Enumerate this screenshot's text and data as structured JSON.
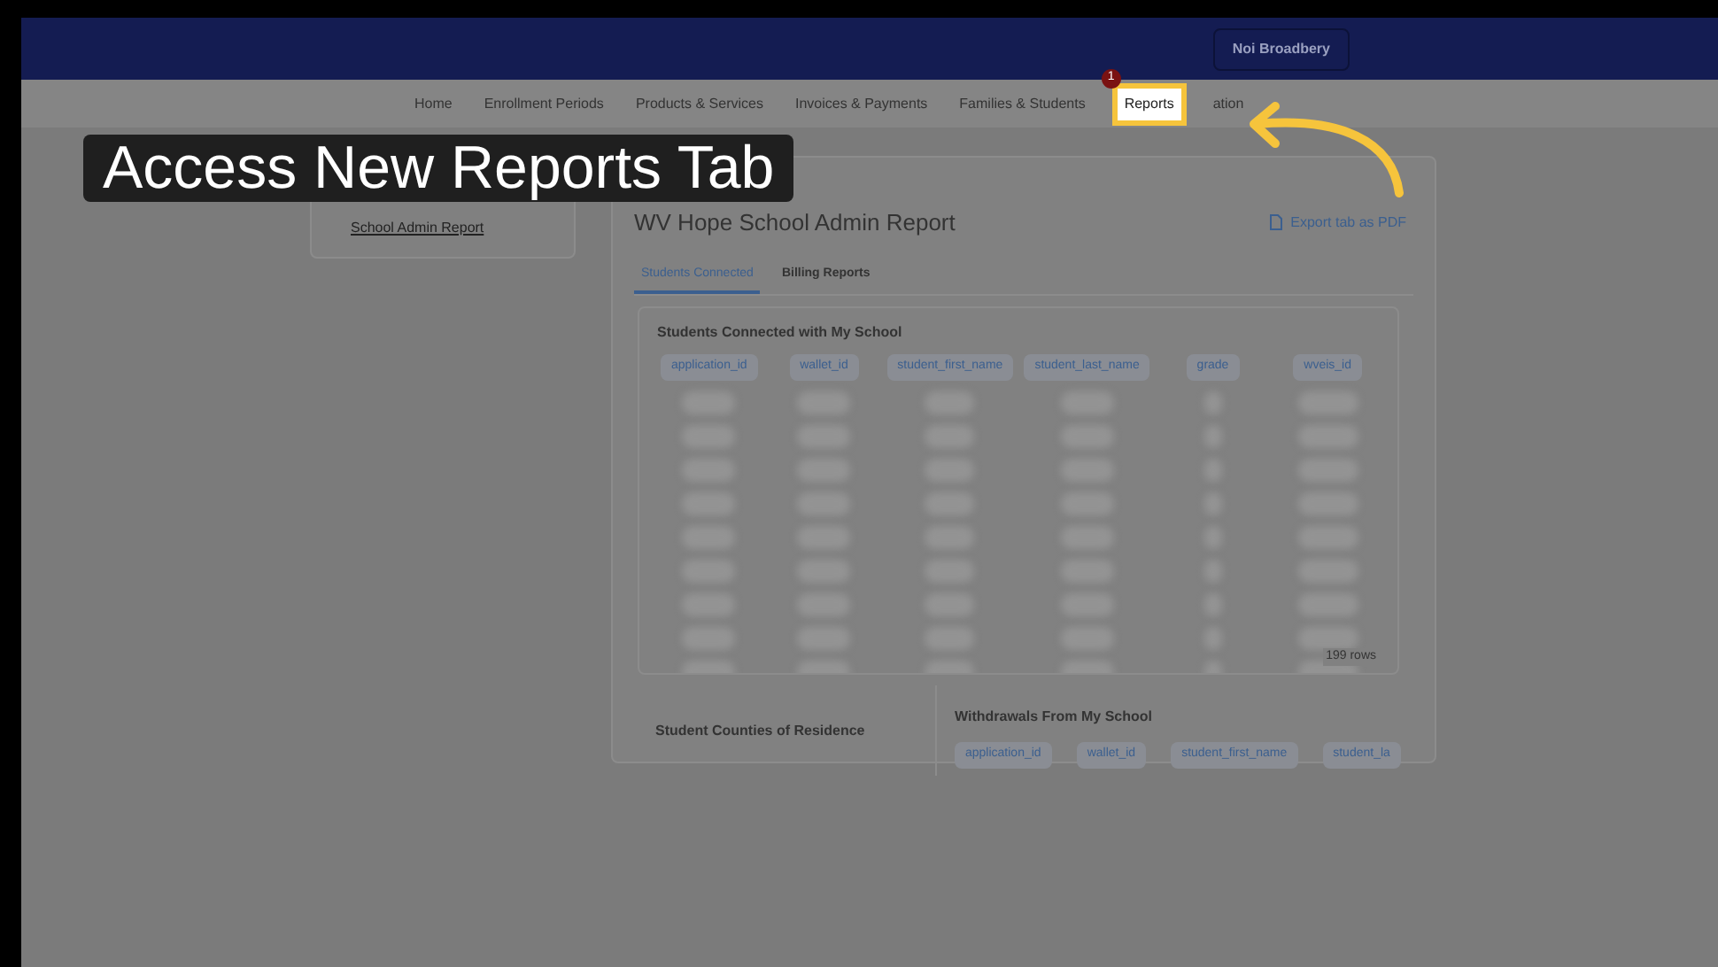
{
  "header": {
    "user_button": "Noi Broadbery"
  },
  "nav": [
    {
      "label": "Home",
      "selected": false
    },
    {
      "label": "Enrollment Periods",
      "selected": false
    },
    {
      "label": "Products & Services",
      "selected": false
    },
    {
      "label": "Invoices & Payments",
      "selected": false
    },
    {
      "label": "Families & Students",
      "selected": false
    },
    {
      "label": "Reports",
      "selected": true,
      "badge": "1"
    },
    {
      "label": "ation",
      "selected": false
    }
  ],
  "callout": {
    "text": "Access New Reports Tab"
  },
  "sidebar": {
    "links": [
      "School Admin Report"
    ]
  },
  "report": {
    "title": "WV Hope School Admin Report",
    "export": "Export tab as PDF",
    "tabs": [
      {
        "label": "Students Connected",
        "selected": true
      },
      {
        "label": "Billing Reports",
        "selected": false
      }
    ],
    "table": {
      "title": "Students Connected with My School",
      "columns": [
        "application_id",
        "wallet_id",
        "student_first_name",
        "student_last_name",
        "grade",
        "wveis_id"
      ],
      "row_count": "199 rows"
    },
    "counties": {
      "title": "Student Counties of Residence"
    },
    "withdrawals": {
      "title": "Withdrawals From My School",
      "columns": [
        "application_id",
        "wallet_id",
        "student_first_name",
        "student_la"
      ]
    }
  }
}
